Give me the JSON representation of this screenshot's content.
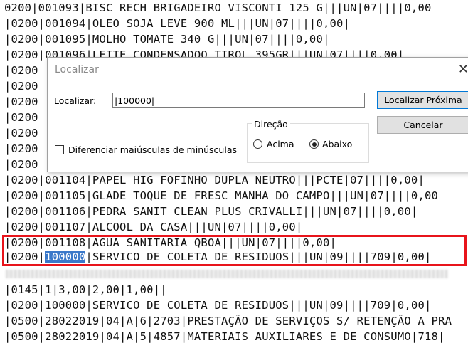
{
  "editor": {
    "lines": [
      {
        "text": "0200|001093|BISC RECH BRIGADEIRO VISCONTI 125 G|||UN|07||||0,00"
      },
      {
        "text": "|0200|001094|OLEO SOJA LEVE 900 ML|||UN|07||||0,00|"
      },
      {
        "text": "|0200|001095|MOLHO TOMATE 340 G|||UN|07||||0,00|"
      },
      {
        "text": "|0200|001096|LEITE CONDENSADOO TIROL 395GR|||UN|07||||0,00|"
      },
      {
        "text": "|0200"
      },
      {
        "text": "|0200"
      },
      {
        "text": "|0200"
      },
      {
        "text": "|0200"
      },
      {
        "text": "|0200"
      },
      {
        "text": "|0200"
      },
      {
        "text": "|0200"
      },
      {
        "text": "|0200|001104|PAPEL HIG FOFINHO DUPLA NEUTRO|||PCTE|07||||0,00|"
      },
      {
        "text": "|0200|001105|GLADE TOQUE DE FRESC MANHA DO CAMPO|||UN|07||||0,00"
      },
      {
        "text": "|0200|001106|PEDRA SANIT CLEAN PLUS CRIVALLI|||UN|07||||0,00|"
      },
      {
        "text": "|0200|001107|ALCOOL DA CASA|||UN|07||||0,00|"
      },
      {
        "text": "|0200|001108|AGUA SANITARIA QBOA|||UN|07||||0,00|"
      },
      {
        "text": "|0200|",
        "highlight": "100000",
        "rest": "|SERVICO DE COLETA DE RESIDUOS|||UN|09||||709|0,00|"
      },
      {
        "text": ""
      },
      {
        "text": "|0145|1|3,00|2,00|1,00||"
      },
      {
        "text": "|0200|100000|SERVICO DE COLETA DE RESIDUOS|||UN|09||||709|0,00|"
      },
      {
        "text": "|0500|28022019|04|A|6|2703|PRESTAÇÃO DE SERVIÇOS S/ RETENÇÃO A PRA"
      },
      {
        "text": "|0500|28022019|04|A|5|4857|MATERIAIS AUXILIARES E DE CONSUMO|718|"
      }
    ]
  },
  "dialog": {
    "title": "Localizar",
    "close_glyph": "✕",
    "find_label": "Localizar:",
    "find_value": "|100000|",
    "find_next_button": "Localizar Próxima",
    "cancel_button": "Cancelar",
    "match_case_label": "Diferenciar maiúsculas de minúsculas",
    "direction_label": "Direção",
    "direction_up": "Acima",
    "direction_down": "Abaixo",
    "selected_direction": "down"
  },
  "colors": {
    "selection": "#3a78c9",
    "annotation_box": "#e8141b"
  }
}
